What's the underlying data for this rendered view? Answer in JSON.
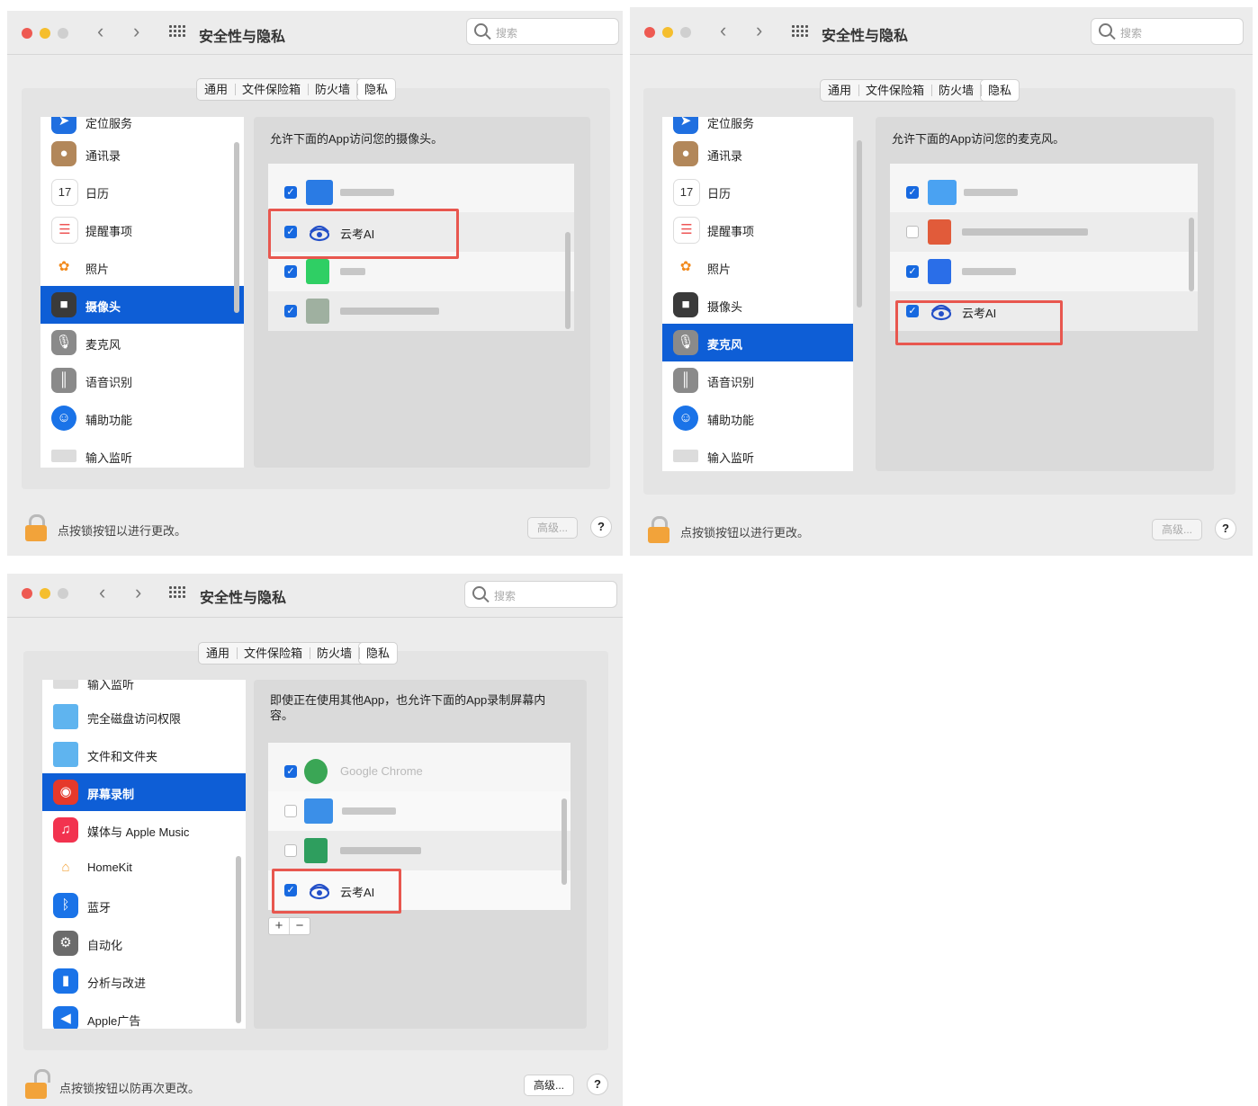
{
  "windows": [
    {
      "title": "安全性与隐私",
      "search_placeholder": "搜索",
      "tabs": [
        "通用",
        "文件保险箱",
        "防火墙",
        "隐私"
      ],
      "selected_tab": "隐私",
      "sidebar_items": [
        {
          "label": "定位服务",
          "icon": "location-icon",
          "color": "#1f6fe0"
        },
        {
          "label": "通讯录",
          "icon": "contacts-icon",
          "color": "#b2875a"
        },
        {
          "label": "日历",
          "icon": "calendar-icon",
          "color": "#ffffff"
        },
        {
          "label": "提醒事项",
          "icon": "reminders-icon",
          "color": "#ffffff"
        },
        {
          "label": "照片",
          "icon": "photos-icon",
          "color": "#ffffff"
        },
        {
          "label": "摄像头",
          "icon": "camera-icon",
          "color": "#3a3a3a",
          "selected": true
        },
        {
          "label": "麦克风",
          "icon": "microphone-icon",
          "color": "#8a8a8a"
        },
        {
          "label": "语音识别",
          "icon": "speech-recognition-icon",
          "color": "#8a8a8a"
        },
        {
          "label": "辅助功能",
          "icon": "accessibility-icon",
          "color": "#1a73e8"
        },
        {
          "label": "输入监听",
          "icon": "keyboard-icon",
          "color": "#dcdcdc"
        }
      ],
      "description": "允许下面的App访问您的摄像头。",
      "apps": [
        {
          "name": "",
          "checked": true,
          "blurred": true
        },
        {
          "name": "云考AI",
          "checked": true,
          "highlighted": true
        },
        {
          "name": "",
          "checked": true,
          "blurred": true
        },
        {
          "name": "",
          "checked": true,
          "blurred": true
        }
      ],
      "footer_text": "点按锁按钮以进行更改。",
      "advanced_label": "高级...",
      "advanced_enabled": false,
      "lock_state": "locked"
    },
    {
      "title": "安全性与隐私",
      "search_placeholder": "搜索",
      "tabs": [
        "通用",
        "文件保险箱",
        "防火墙",
        "隐私"
      ],
      "selected_tab": "隐私",
      "sidebar_items": [
        {
          "label": "定位服务",
          "icon": "location-icon",
          "color": "#1f6fe0"
        },
        {
          "label": "通讯录",
          "icon": "contacts-icon",
          "color": "#b2875a"
        },
        {
          "label": "日历",
          "icon": "calendar-icon",
          "color": "#ffffff"
        },
        {
          "label": "提醒事项",
          "icon": "reminders-icon",
          "color": "#ffffff"
        },
        {
          "label": "照片",
          "icon": "photos-icon",
          "color": "#ffffff"
        },
        {
          "label": "摄像头",
          "icon": "camera-icon",
          "color": "#3a3a3a"
        },
        {
          "label": "麦克风",
          "icon": "microphone-icon",
          "color": "#8a8a8a",
          "selected": true
        },
        {
          "label": "语音识别",
          "icon": "speech-recognition-icon",
          "color": "#8a8a8a"
        },
        {
          "label": "辅助功能",
          "icon": "accessibility-icon",
          "color": "#1a73e8"
        },
        {
          "label": "输入监听",
          "icon": "keyboard-icon",
          "color": "#dcdcdc"
        }
      ],
      "description": "允许下面的App访问您的麦克风。",
      "apps": [
        {
          "name": "",
          "checked": true,
          "blurred": true
        },
        {
          "name": "",
          "checked": false,
          "blurred": true
        },
        {
          "name": "",
          "checked": true,
          "blurred": true
        },
        {
          "name": "云考AI",
          "checked": true,
          "highlighted": true
        }
      ],
      "footer_text": "点按锁按钮以进行更改。",
      "advanced_label": "高级...",
      "advanced_enabled": false,
      "lock_state": "locked"
    },
    {
      "title": "安全性与隐私",
      "search_placeholder": "搜索",
      "tabs": [
        "通用",
        "文件保险箱",
        "防火墙",
        "隐私"
      ],
      "selected_tab": "隐私",
      "sidebar_items": [
        {
          "label": "输入监听",
          "icon": "keyboard-icon",
          "color": "#dcdcdc"
        },
        {
          "label": "完全磁盘访问权限",
          "icon": "folder-icon",
          "color": "#5fb4ef"
        },
        {
          "label": "文件和文件夹",
          "icon": "folder-icon",
          "color": "#5fb4ef"
        },
        {
          "label": "屏幕录制",
          "icon": "screen-recording-icon",
          "color": "#e5392b",
          "selected": true
        },
        {
          "label": "媒体与 Apple Music",
          "icon": "music-icon",
          "color": "#f2334f"
        },
        {
          "label": "HomeKit",
          "icon": "home-icon",
          "color": "#ffffff"
        },
        {
          "label": "蓝牙",
          "icon": "bluetooth-icon",
          "color": "#1a73e8"
        },
        {
          "label": "自动化",
          "icon": "gear-icon",
          "color": "#6b6b6b"
        },
        {
          "label": "分析与改进",
          "icon": "chart-icon",
          "color": "#1a73e8"
        },
        {
          "label": "Apple广告",
          "icon": "megaphone-icon",
          "color": "#1a73e8"
        }
      ],
      "description": "即使正在使用其他App，也允许下面的App录制屏幕内容。",
      "apps": [
        {
          "name": "Google Chrome",
          "checked": true,
          "blurred": true
        },
        {
          "name": "",
          "checked": false,
          "blurred": true
        },
        {
          "name": "",
          "checked": false,
          "blurred": true
        },
        {
          "name": "云考AI",
          "checked": true,
          "highlighted": true
        }
      ],
      "plus_label": "+",
      "minus_label": "−",
      "footer_text": "点按锁按钮以防再次更改。",
      "advanced_label": "高级...",
      "advanced_enabled": true,
      "lock_state": "unlocked"
    }
  ]
}
